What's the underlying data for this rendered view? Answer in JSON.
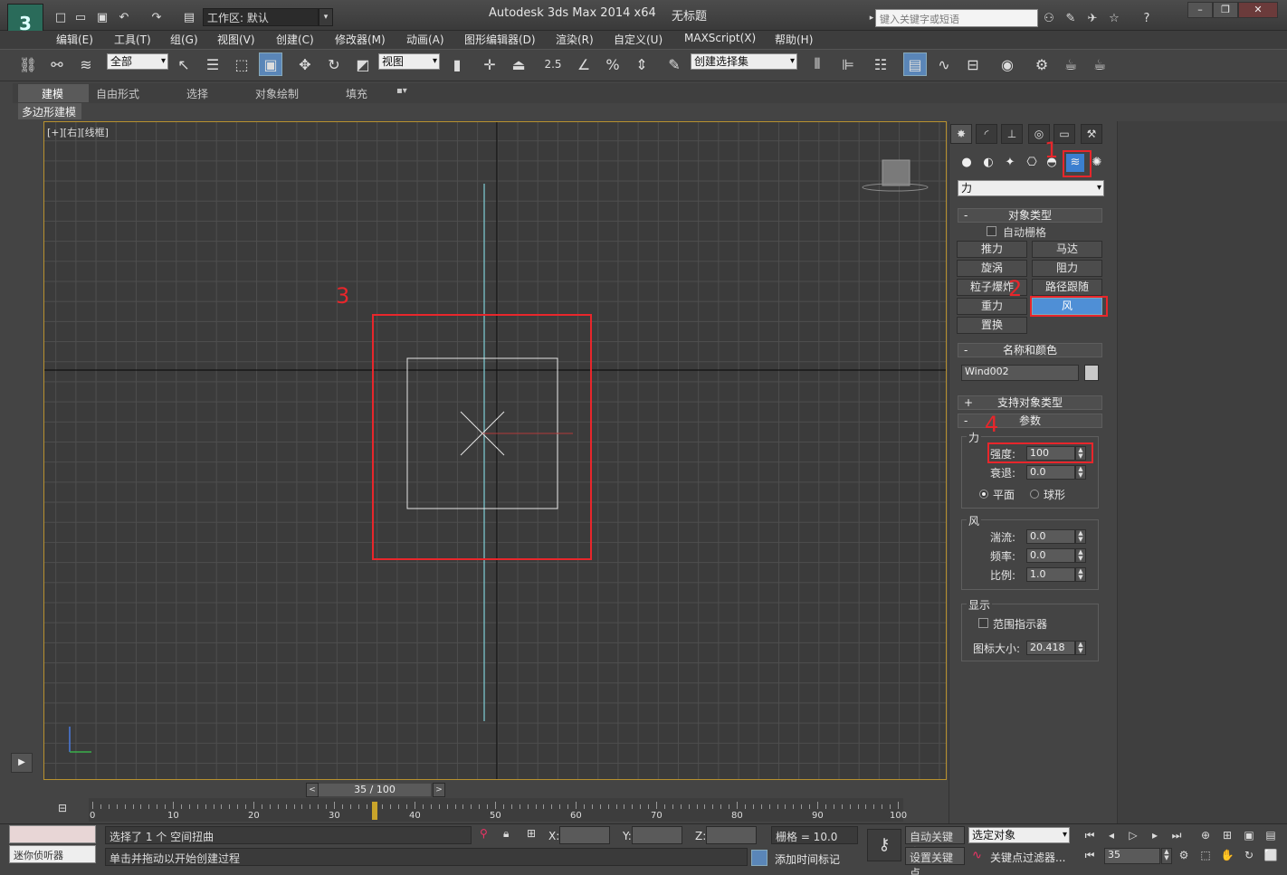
{
  "titlebar": {
    "window_title": "Autodesk 3ds Max  2014 x64",
    "doc_title": "无标题",
    "workspace_label": "工作区: 默认",
    "search_placeholder": "键入关键字或短语"
  },
  "menu": [
    "编辑(E)",
    "工具(T)",
    "组(G)",
    "视图(V)",
    "创建(C)",
    "修改器(M)",
    "动画(A)",
    "图形编辑器(D)",
    "渲染(R)",
    "自定义(U)",
    "MAXScript(X)",
    "帮助(H)"
  ],
  "toolbar": {
    "selection_filter": "全部",
    "ref_coord": "视图",
    "snap_value": "2.5",
    "named_selection": "创建选择集"
  },
  "ribbon": {
    "tabs": [
      "建模",
      "自由形式",
      "选择",
      "对象绘制",
      "填充"
    ],
    "sub_tab": "多边形建模"
  },
  "viewport": {
    "label": "[+][右][线框]",
    "annotations": {
      "a1": "1",
      "a2": "2",
      "a3": "3",
      "a4": "4"
    }
  },
  "command_panel": {
    "category_dropdown": "力",
    "object_type": {
      "header": "对象类型",
      "auto_grid": "自动栅格",
      "buttons": [
        "推力",
        "马达",
        "旋涡",
        "阻力",
        "粒子爆炸",
        "路径跟随",
        "重力",
        "风",
        "置换"
      ],
      "selected": "风"
    },
    "name_color": {
      "header": "名称和颜色",
      "name": "Wind002",
      "color": "#c8c8c8"
    },
    "supports": {
      "header": "支持对象类型"
    },
    "params": {
      "header": "参数",
      "force_group": "力",
      "strength_label": "强度:",
      "strength_value": "100",
      "decay_label": "衰退:",
      "decay_value": "0.0",
      "planar": "平面",
      "spherical": "球形",
      "wind_group": "风",
      "turbulence_label": "湍流:",
      "turbulence_value": "0.0",
      "frequency_label": "频率:",
      "frequency_value": "0.0",
      "scale_label": "比例:",
      "scale_value": "1.0",
      "display_group": "显示",
      "range_indicators": "范围指示器",
      "icon_size_label": "图标大小:",
      "icon_size_value": "20.418"
    }
  },
  "timeline": {
    "frame_label": "35 / 100",
    "ticks": [
      "0",
      "10",
      "20",
      "30",
      "40",
      "50",
      "60",
      "70",
      "80",
      "90",
      "100"
    ],
    "current_frame": 35,
    "total_frames": 100
  },
  "status": {
    "listener": "迷你侦听器",
    "selection_msg": "选择了 1 个 空间扭曲",
    "prompt_msg": "单击并拖动以开始创建过程",
    "x_label": "X:",
    "y_label": "Y:",
    "z_label": "Z:",
    "grid_label": "栅格 = 10.0",
    "add_time_tag": "添加时间标记",
    "auto_key": "自动关键点",
    "set_key": "设置关键点",
    "selected_object": "选定对象",
    "key_filters": "关键点过滤器...",
    "frame_field": "35"
  }
}
